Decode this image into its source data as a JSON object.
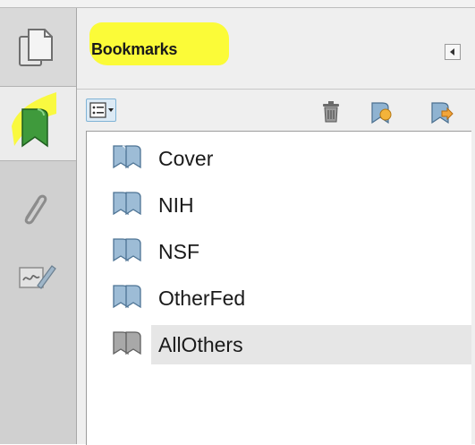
{
  "panel": {
    "title": "Bookmarks"
  },
  "bookmarks": [
    {
      "label": "Cover",
      "selected": false
    },
    {
      "label": "NIH",
      "selected": false
    },
    {
      "label": "NSF",
      "selected": false
    },
    {
      "label": "OtherFed",
      "selected": false
    },
    {
      "label": "AllOthers",
      "selected": true
    }
  ],
  "rail": [
    "pages-icon",
    "bookmark-icon",
    "paperclip-icon",
    "signature-icon"
  ],
  "toolbar": [
    "options-menu-icon",
    "trash-icon",
    "new-bookmark-icon",
    "expand-bookmark-icon"
  ],
  "colors": {
    "highlight": "#fbfb2d",
    "bookmark_green": "#3f9a3c",
    "bookmark_blue": "#7aa6c8",
    "selection": "#e6e6e6"
  }
}
